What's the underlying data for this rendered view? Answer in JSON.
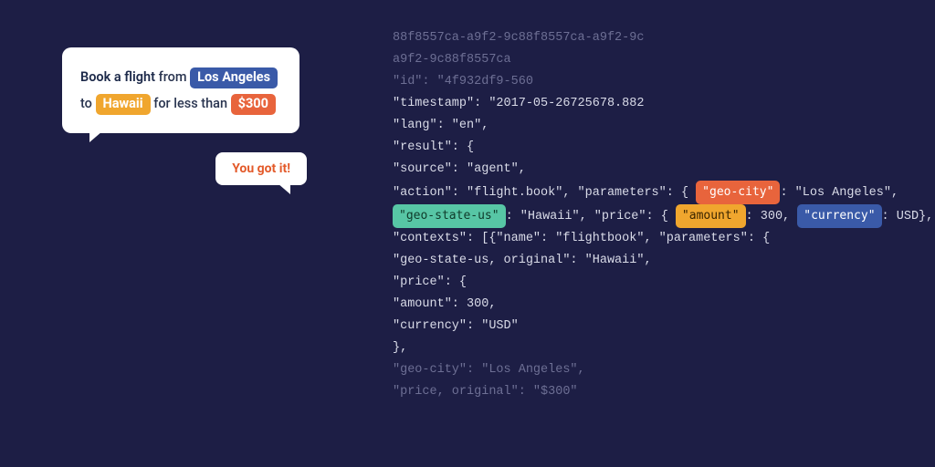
{
  "chat": {
    "user": {
      "prefix_bold": "Book a flight",
      "t1": " from ",
      "chip_la": "Los Angeles",
      "t2": "to ",
      "chip_hi": "Hawaii",
      "t3": " for less than ",
      "chip_price": "$300"
    },
    "agent_reply": "You got it!"
  },
  "json_view": {
    "l0": "88f8557ca-a9f2-9c88f8557ca-a9f2-9c",
    "l1": "a9f2-9c88f8557ca",
    "l2": "\"id\": \"4f932df9-560",
    "l3": "\"timestamp\": \"2017-05-26725678.882",
    "l4": "\"lang\": \"en\",",
    "l5": "\"result\": {",
    "l6": "\"source\": \"agent\",",
    "l7_a": "\"action\": \"flight.book\", \"parameters\": {",
    "l7_chip_geocity": "\"geo-city\"",
    "l7_b": ": \"Los Angeles\",",
    "l8_chip_geostate": "\"geo-state-us\"",
    "l8_a": ": \"Hawaii\", \"price\": {",
    "l8_chip_amount": "\"amount\"",
    "l8_b": ": 300, ",
    "l8_chip_currency": "\"currency\"",
    "l8_c": ": USD},",
    "l9": "\"contexts\": [{\"name\": \"flightbook\", \"parameters\": {",
    "l10": "\"geo-state-us, original\": \"Hawaii\",",
    "l11": "\"price\": {",
    "l12": "\"amount\": 300,",
    "l13": "\"currency\": \"USD\"",
    "l14": "},",
    "l15": "\"geo-city\": \"Los Angeles\",",
    "l16": "\"price, original\": \"$300\""
  }
}
